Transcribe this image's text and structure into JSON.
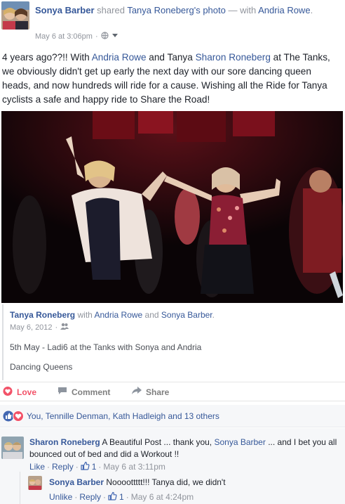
{
  "post": {
    "author": "Sonya Barber",
    "action": "shared",
    "photo_owner": "Tanya Roneberg",
    "photo_owner_suffix": "'s photo",
    "with_prefix": "— with",
    "tagged": "Andria Rowe",
    "period": ".",
    "timestamp": "May 6 at 3:06pm",
    "separator": "·",
    "audience_icon": "globe-icon",
    "menu_icon": "chevron-down-icon",
    "text_part1": "4 years ago??!! With ",
    "text_link1": "Andria Rowe",
    "text_part2": " and Tanya ",
    "text_link2": "Sharon Roneberg",
    "text_part3": " at The Tanks, we obviously didn't get up early the next day with our sore dancing queen heads, and now hundreds will ride for a cause. Wishing all the Ride for Tanya cyclists a safe and happy ride to Share the Road!"
  },
  "shared": {
    "owner": "Tanya Roneberg",
    "with_word": "with",
    "tag1": "Andria Rowe",
    "and_word": "and",
    "tag2": "Sonya Barber",
    "period": ".",
    "date": "May 6, 2012",
    "separator": "·",
    "audience_icon": "friends-icon",
    "caption1": "5th May - Ladi6 at the Tanks with Sonya and Andria",
    "caption2": "Dancing Queens"
  },
  "actions": {
    "love": "Love",
    "comment": "Comment",
    "share": "Share"
  },
  "reactions": {
    "summary": "You, Tennille Denman, Kath Hadleigh and 13 others"
  },
  "comments": [
    {
      "author": "Sharon Roneberg",
      "text_part1": "A Beautiful Post ... thank you, ",
      "mention": "Sonya Barber",
      "text_part2": " ... and I bet you all bounced out of bed and did a Workout !!",
      "like": "Like",
      "sep1": "·",
      "reply": "Reply",
      "sep2": "·",
      "likes": "1",
      "sep3": "·",
      "time": "May 6 at 3:11pm"
    },
    {
      "author": "Sonya Barber",
      "text": "Noooottttt!!! Tanya did, we didn't",
      "unlike": "Unlike",
      "sep1": "·",
      "reply": "Reply",
      "sep2": "·",
      "likes": "1",
      "sep3": "·",
      "time": "May 6 at 4:24pm"
    }
  ],
  "colors": {
    "link": "#365899",
    "love": "#f25268",
    "meta": "#90949c",
    "like_blue": "#4267b2"
  }
}
